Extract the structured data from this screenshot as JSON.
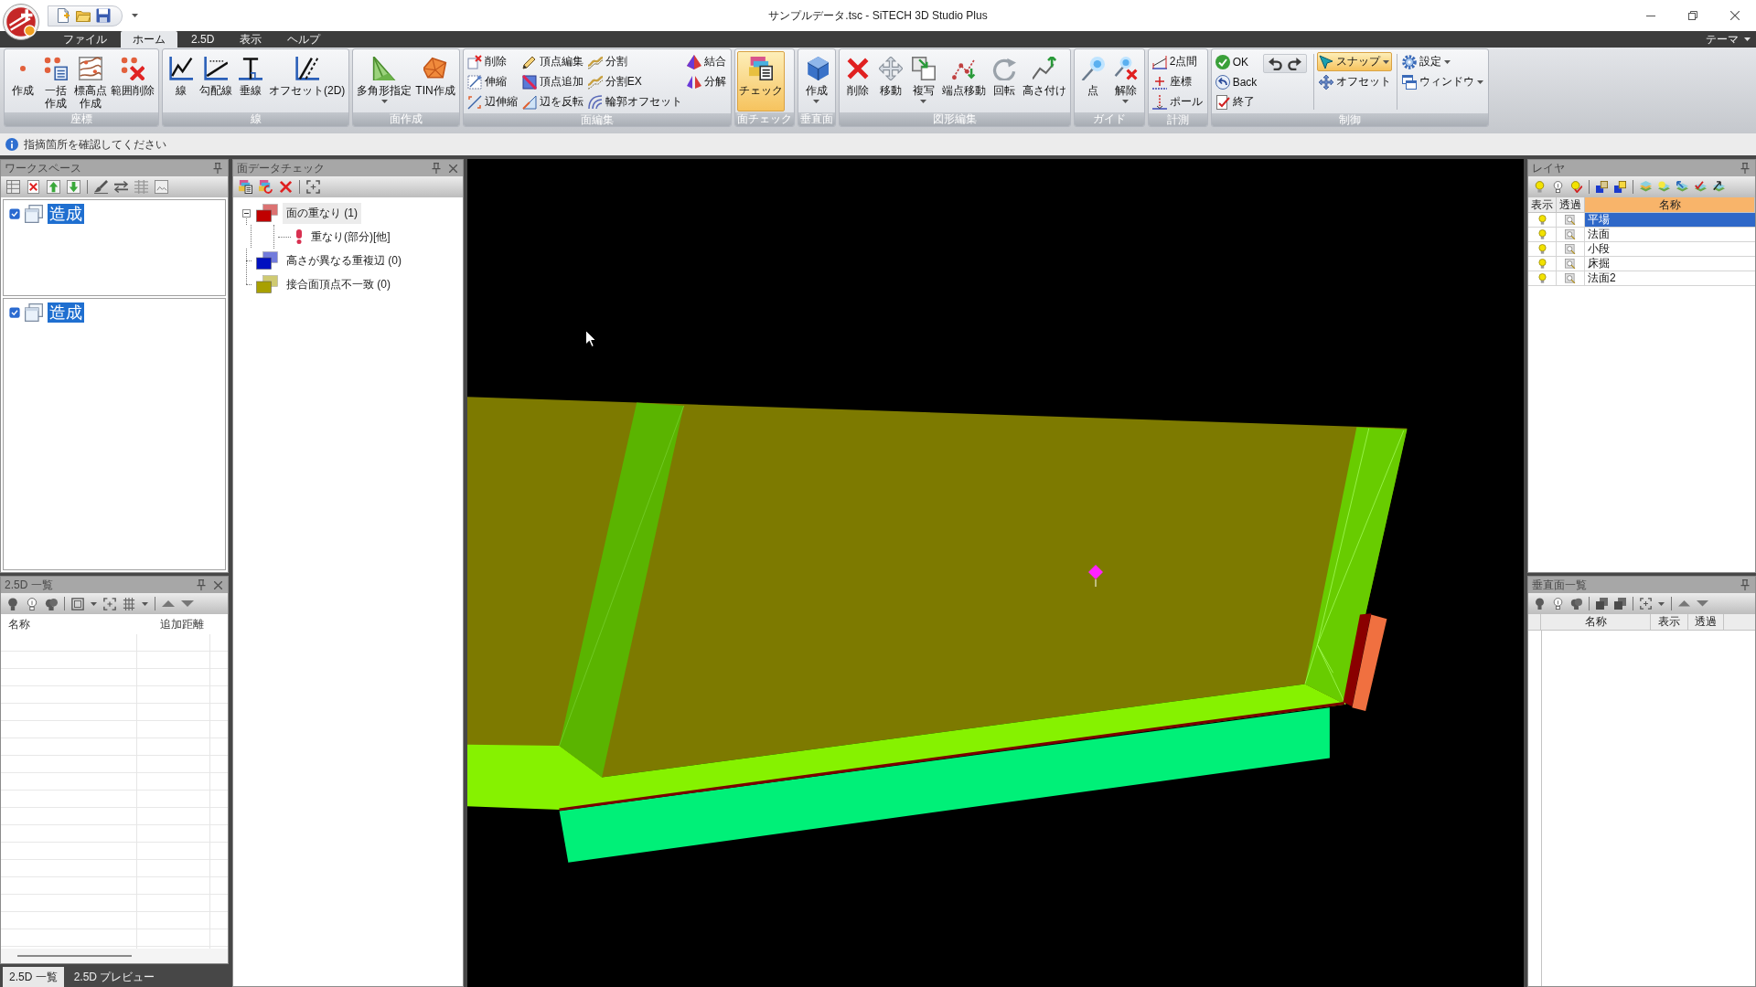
{
  "title_bar": {
    "title": "サンプルデータ.tsc - SiTECH 3D Studio Plus"
  },
  "menu_tabs": [
    {
      "label": "ファイル",
      "selected": false
    },
    {
      "label": "ホーム",
      "selected": true
    },
    {
      "label": "2.5D",
      "selected": false
    },
    {
      "label": "表示",
      "selected": false
    },
    {
      "label": "ヘルプ",
      "selected": false
    }
  ],
  "theme_menu": "テーマ",
  "ribbon": [
    {
      "title": "座標",
      "items": [
        {
          "kind": "large",
          "label": "作成",
          "active": false
        },
        {
          "kind": "large",
          "label": "一括作成",
          "active": false
        },
        {
          "kind": "large",
          "label": "標高点作成",
          "active": false
        },
        {
          "kind": "large",
          "label": "範囲削除",
          "active": false
        }
      ]
    },
    {
      "title": "線",
      "items": [
        {
          "kind": "large",
          "label": "線",
          "active": false
        },
        {
          "kind": "large",
          "label": "勾配線",
          "active": false
        },
        {
          "kind": "large",
          "label": "垂線",
          "active": false
        },
        {
          "kind": "large",
          "label": "オフセット(2D)",
          "active": false
        }
      ]
    },
    {
      "title": "面作成",
      "items": [
        {
          "kind": "large",
          "label": "多角形指定",
          "active": false,
          "dropdown": true
        },
        {
          "kind": "large",
          "label": "TIN作成",
          "active": false
        }
      ]
    },
    {
      "title": "面編集",
      "items": [
        {
          "kind": "stack",
          "buttons": [
            {
              "label": "削除",
              "active": false
            },
            {
              "label": "伸縮",
              "active": false
            },
            {
              "label": "辺伸縮",
              "active": false
            }
          ]
        },
        {
          "kind": "stack",
          "buttons": [
            {
              "label": "頂点編集",
              "active": false
            },
            {
              "label": "頂点追加",
              "active": false
            },
            {
              "label": "辺を反転",
              "active": false
            }
          ]
        },
        {
          "kind": "stack",
          "buttons": [
            {
              "label": "分割",
              "active": false
            },
            {
              "label": "分割EX",
              "active": false
            },
            {
              "label": "輪郭オフセット",
              "active": false
            }
          ]
        },
        {
          "kind": "stack",
          "buttons": [
            {
              "label": "結合",
              "active": false
            },
            {
              "label": "分解",
              "active": false
            }
          ]
        }
      ]
    },
    {
      "title": "面チェック",
      "items": [
        {
          "kind": "large",
          "label": "チェック",
          "active": true
        }
      ]
    },
    {
      "title": "垂直面",
      "items": [
        {
          "kind": "large",
          "label": "作成",
          "active": false,
          "dropdown": true
        }
      ]
    },
    {
      "title": "図形編集",
      "items": [
        {
          "kind": "large",
          "label": "削除",
          "active": false
        },
        {
          "kind": "large",
          "label": "移動",
          "active": false
        },
        {
          "kind": "large",
          "label": "複写",
          "active": false,
          "dropdown": true
        },
        {
          "kind": "large",
          "label": "端点移動",
          "active": false
        },
        {
          "kind": "large",
          "label": "回転",
          "active": false
        },
        {
          "kind": "large",
          "label": "高さ付け",
          "active": false
        }
      ]
    },
    {
      "title": "ガイド",
      "items": [
        {
          "kind": "large",
          "label": "点",
          "active": false
        },
        {
          "kind": "large",
          "label": "解除",
          "active": false,
          "dropdown": true
        }
      ]
    },
    {
      "title": "計測",
      "items": [
        {
          "kind": "stack",
          "buttons": [
            {
              "label": "2点間",
              "active": false
            },
            {
              "label": "座標",
              "active": false
            },
            {
              "label": "ポール",
              "active": false
            }
          ]
        }
      ]
    },
    {
      "title": "制御",
      "items": [
        {
          "kind": "stack",
          "buttons": [
            {
              "label": "OK",
              "active": false
            },
            {
              "label": "Back",
              "active": false
            },
            {
              "label": "終了",
              "active": false
            }
          ]
        },
        {
          "kind": "history"
        },
        {
          "kind": "separator"
        },
        {
          "kind": "stack",
          "buttons": [
            {
              "label": "スナップ",
              "active": true,
              "dropdown": true
            },
            {
              "label": "オフセット",
              "active": false
            }
          ]
        },
        {
          "kind": "separator"
        },
        {
          "kind": "stack",
          "buttons": [
            {
              "label": "設定",
              "active": false,
              "dropdown": true
            },
            {
              "label": "ウィンドウ",
              "active": false,
              "dropdown": true
            }
          ]
        }
      ]
    }
  ],
  "info_bar": {
    "message": "指摘箇所を確認してください"
  },
  "workspace": {
    "title": "ワークスペース",
    "lists": [
      {
        "items": [
          {
            "label": "造成",
            "checked": true,
            "selected": true
          }
        ]
      },
      {
        "items": [
          {
            "label": "造成",
            "checked": true,
            "selected": true
          }
        ]
      }
    ]
  },
  "list_25d": {
    "title": "2.5D 一覧",
    "columns": [
      "名称",
      "追加距離"
    ]
  },
  "bottom_tabs": [
    {
      "label": "2.5D 一覧",
      "selected": true
    },
    {
      "label": "2.5D プレビュー",
      "selected": false
    }
  ],
  "check_panel": {
    "title": "面データチェック",
    "tree": [
      {
        "label": "面の重なり (1)",
        "color": "#c00000",
        "selected": true,
        "expanded": true,
        "children": [
          {
            "label": "重なり(部分)[他]",
            "selected": false
          }
        ]
      },
      {
        "label": "高さが異なる重複辺 (0)",
        "color": "#0010c0",
        "selected": false
      },
      {
        "label": "接合面頂点不一致 (0)",
        "color": "#a8a000",
        "selected": false
      }
    ]
  },
  "layer_panel": {
    "title": "レイヤ",
    "columns": [
      {
        "label": "表示",
        "sorted": false
      },
      {
        "label": "透過",
        "sorted": false
      },
      {
        "label": "名称",
        "sorted": true
      }
    ],
    "rows": [
      {
        "name": "平場",
        "visible": true,
        "selected": true
      },
      {
        "name": "法面",
        "visible": true,
        "selected": false
      },
      {
        "name": "小段",
        "visible": true,
        "selected": false
      },
      {
        "name": "床掘",
        "visible": true,
        "selected": false
      },
      {
        "name": "法面2",
        "visible": true,
        "selected": false
      }
    ]
  },
  "vertical_panel": {
    "title": "垂直面一覧",
    "columns": [
      "名称",
      "表示",
      "透過"
    ]
  }
}
